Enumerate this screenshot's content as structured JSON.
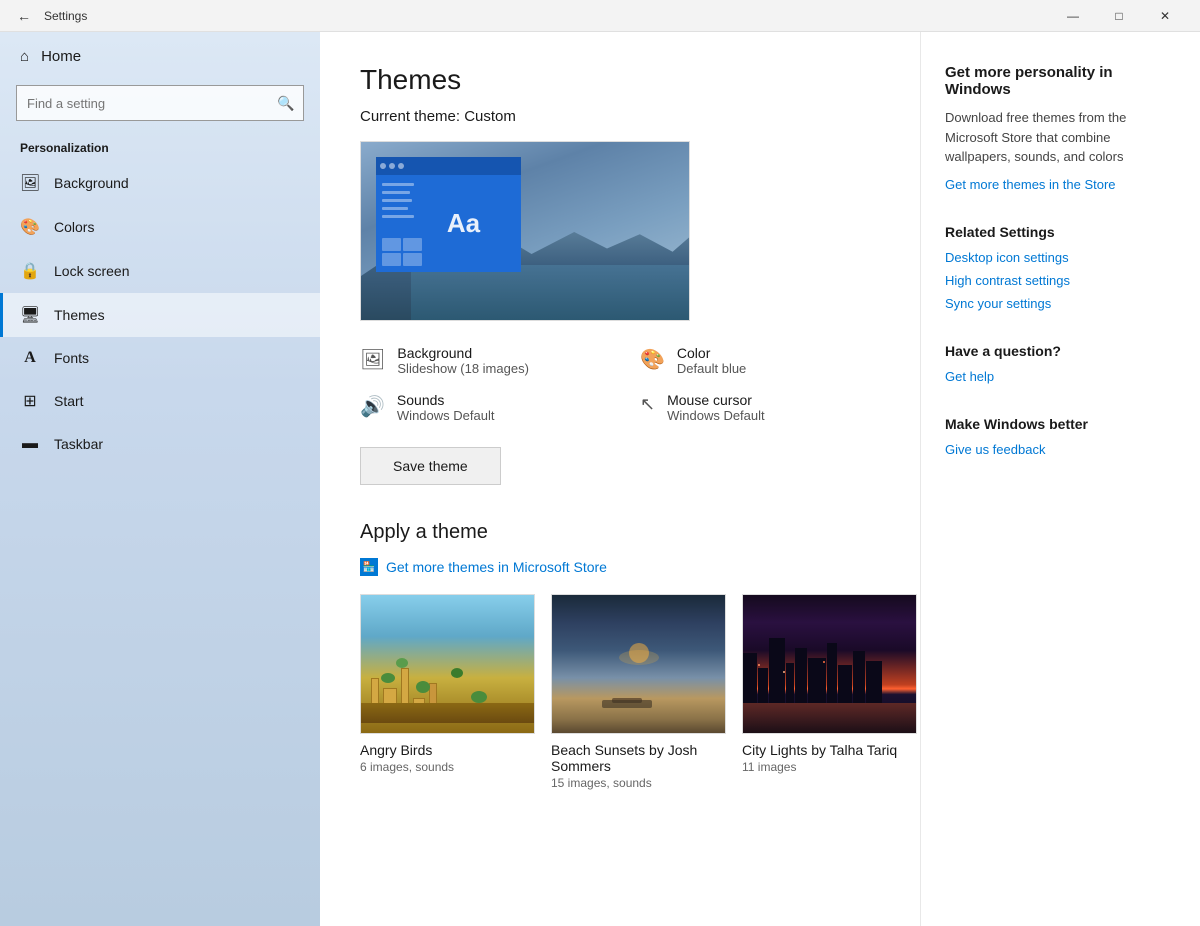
{
  "titlebar": {
    "back_label": "←",
    "title": "Settings",
    "minimize_label": "—",
    "maximize_label": "□",
    "close_label": "✕"
  },
  "sidebar": {
    "home_label": "Home",
    "search_placeholder": "Find a setting",
    "section_label": "Personalization",
    "items": [
      {
        "id": "background",
        "label": "Background",
        "icon": "🖼"
      },
      {
        "id": "colors",
        "label": "Colors",
        "icon": "🎨"
      },
      {
        "id": "lock-screen",
        "label": "Lock screen",
        "icon": "🔒"
      },
      {
        "id": "themes",
        "label": "Themes",
        "icon": "🖥"
      },
      {
        "id": "fonts",
        "label": "Fonts",
        "icon": "A"
      },
      {
        "id": "start",
        "label": "Start",
        "icon": "⊞"
      },
      {
        "id": "taskbar",
        "label": "Taskbar",
        "icon": "▬"
      }
    ]
  },
  "main": {
    "page_title": "Themes",
    "current_theme_label": "Current theme: Custom",
    "settings": [
      {
        "icon": "🖼",
        "name": "Background",
        "value": "Slideshow (18 images)"
      },
      {
        "icon": "🎨",
        "name": "Color",
        "value": "Default blue"
      },
      {
        "icon": "🔊",
        "name": "Sounds",
        "value": "Windows Default"
      },
      {
        "icon": "↖",
        "name": "Mouse cursor",
        "value": "Windows Default"
      }
    ],
    "save_theme_label": "Save theme",
    "apply_section_label": "Apply a theme",
    "get_more_link_label": "Get more themes in Microsoft Store",
    "themes": [
      {
        "name": "Angry Birds",
        "desc": "6 images, sounds",
        "type": "angry"
      },
      {
        "name": "Beach Sunsets by Josh Sommers",
        "desc": "15 images, sounds",
        "type": "beach"
      },
      {
        "name": "City Lights by Talha Tariq",
        "desc": "11 images",
        "type": "city"
      }
    ]
  },
  "right_panel": {
    "get_more_title": "Get more personality in Windows",
    "get_more_desc": "Download free themes from the Microsoft Store that combine wallpapers, sounds, and colors",
    "get_more_link": "Get more themes in the Store",
    "related_title": "Related Settings",
    "related_links": [
      "Desktop icon settings",
      "High contrast settings",
      "Sync your settings"
    ],
    "question_title": "Have a question?",
    "question_link": "Get help",
    "feedback_title": "Make Windows better",
    "feedback_link": "Give us feedback"
  }
}
